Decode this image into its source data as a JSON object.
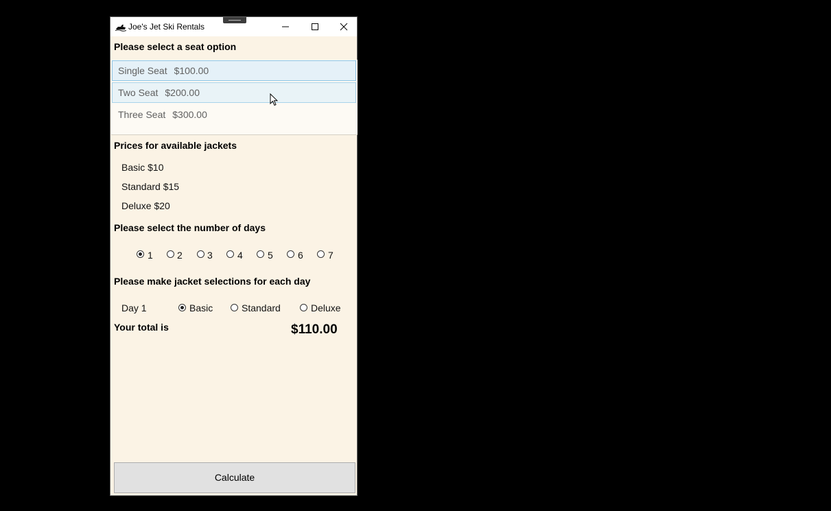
{
  "window": {
    "title": "Joe's Jet Ski Rentals",
    "app_icon": "jet-ski-icon"
  },
  "seat": {
    "heading": "Please select a seat option",
    "options": [
      {
        "name": "Single Seat",
        "price": "$100.00"
      },
      {
        "name": "Two Seat",
        "price": "$200.00"
      },
      {
        "name": "Three Seat",
        "price": "$300.00"
      }
    ]
  },
  "jackets": {
    "heading": "Prices for available jackets",
    "items": [
      "Basic $10",
      "Standard $15",
      "Deluxe $20"
    ]
  },
  "days": {
    "heading": "Please select the number of days",
    "options": [
      "1",
      "2",
      "3",
      "4",
      "5",
      "6",
      "7"
    ],
    "selected": "1"
  },
  "jacket_selection": {
    "heading": "Please make jacket selections for each day",
    "rows": [
      {
        "day": "Day 1",
        "options": [
          "Basic",
          "Standard",
          "Deluxe"
        ],
        "selected": "Basic"
      }
    ]
  },
  "total": {
    "label": "Your total is",
    "value": "$110.00"
  },
  "calculate_label": "Calculate"
}
